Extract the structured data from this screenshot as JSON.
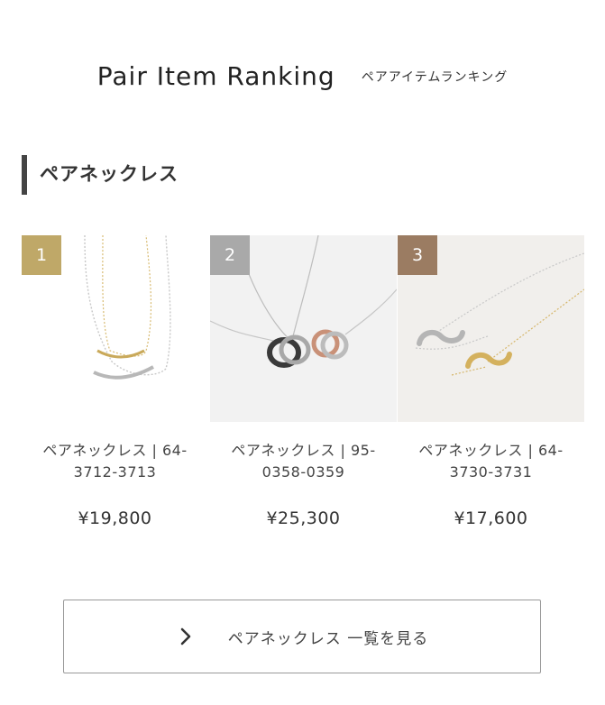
{
  "header": {
    "title_en": "Pair Item Ranking",
    "title_jp": "ペアアイテムランキング"
  },
  "section": {
    "title": "ペアネックレス"
  },
  "colors": {
    "rank1": "#bfa868",
    "rank2": "#a9a9a9",
    "rank3": "#9b7c62"
  },
  "products": [
    {
      "rank": "1",
      "name": "ペアネックレス | 64-3712-3713",
      "price": "¥19,800"
    },
    {
      "rank": "2",
      "name": "ペアネックレス | 95-0358-0359",
      "price": "¥25,300"
    },
    {
      "rank": "3",
      "name": "ペアネックレス | 64-3730-3731",
      "price": "¥17,600"
    }
  ],
  "more_button": {
    "label": "ペアネックレス 一覧を見る",
    "icon": "chevron-right-icon"
  }
}
